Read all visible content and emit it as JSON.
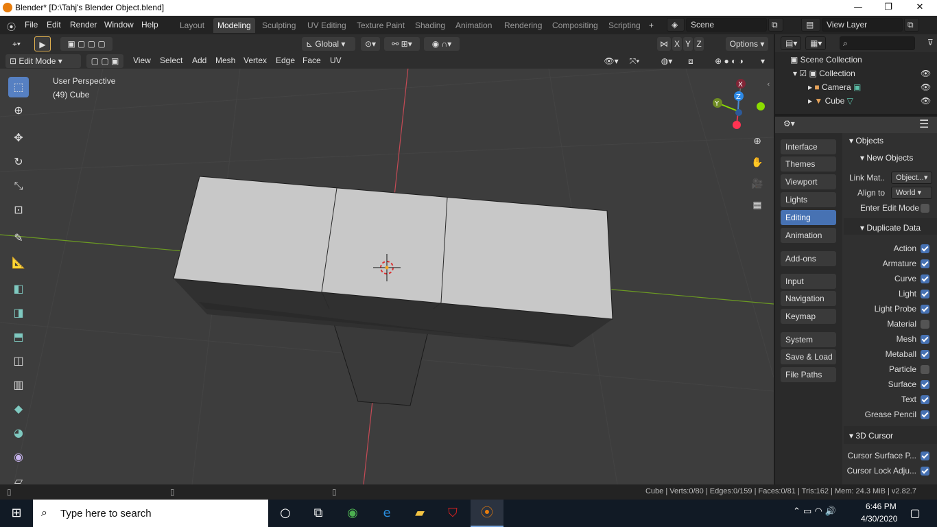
{
  "window": {
    "title": "Blender* [D:\\Tahj's Blender Object.blend]",
    "minimize": "—",
    "maximize": "❐",
    "close": "✕"
  },
  "menu": [
    "File",
    "Edit",
    "Render",
    "Window",
    "Help"
  ],
  "workspaces": [
    "Layout",
    "Modeling",
    "Sculpting",
    "UV Editing",
    "Texture Paint",
    "Shading",
    "Animation",
    "Rendering",
    "Compositing",
    "Scripting"
  ],
  "workspace_add": "+",
  "scene": {
    "name": "Scene"
  },
  "view_layer": {
    "name": "View Layer"
  },
  "viewport_header": {
    "transform_orientation": "Global",
    "options": "Options",
    "mode": "Edit Mode",
    "menus": [
      "View",
      "Select",
      "Add",
      "Mesh",
      "Vertex",
      "Edge",
      "Face",
      "UV"
    ],
    "axis_x": "X",
    "axis_y": "Y",
    "axis_z": "Z"
  },
  "viewport": {
    "perspective": "User Perspective",
    "object_info": "(49) Cube"
  },
  "gizmo": {
    "x": "X",
    "y": "Y",
    "z": "Z"
  },
  "outliner": {
    "search_placeholder": "",
    "scene_collection": "Scene Collection",
    "collection": "Collection",
    "items": [
      "Camera",
      "Cube"
    ]
  },
  "preferences": {
    "categories": [
      "Interface",
      "Themes",
      "Viewport",
      "Lights",
      "Editing",
      "Animation",
      "Add-ons",
      "Input",
      "Navigation",
      "Keymap",
      "System",
      "Save & Load",
      "File Paths"
    ],
    "active_category": "Editing",
    "objects_title": "Objects",
    "new_objects_title": "New Objects",
    "link_materials_label": "Link Mat..",
    "link_materials_value": "Object...",
    "align_to_label": "Align to",
    "align_to_value": "World",
    "enter_edit_mode_label": "Enter Edit Mode",
    "enter_edit_mode": false,
    "duplicate_data_title": "Duplicate Data",
    "duplicate": [
      {
        "label": "Action",
        "checked": true
      },
      {
        "label": "Armature",
        "checked": true
      },
      {
        "label": "Curve",
        "checked": true
      },
      {
        "label": "Light",
        "checked": true
      },
      {
        "label": "Light Probe",
        "checked": true
      },
      {
        "label": "Material",
        "checked": false
      },
      {
        "label": "Mesh",
        "checked": true
      },
      {
        "label": "Metaball",
        "checked": true
      },
      {
        "label": "Particle",
        "checked": false
      },
      {
        "label": "Surface",
        "checked": true
      },
      {
        "label": "Text",
        "checked": true
      },
      {
        "label": "Grease Pencil",
        "checked": true
      }
    ],
    "cursor_title": "3D Cursor",
    "cursor": [
      {
        "label": "Cursor Surface P...",
        "checked": true
      },
      {
        "label": "Cursor Lock Adju...",
        "checked": true
      }
    ]
  },
  "statusbar": "Cube | Verts:0/80 | Edges:0/159 | Faces:0/81 | Tris:162 | Mem: 24.3 MiB | v2.82.7",
  "taskbar": {
    "search_placeholder": "Type here to search",
    "time": "6:46 PM",
    "date": "4/30/2020"
  },
  "colors": {
    "accent": "#4772b3",
    "viewport_bg": "#3d3d3d",
    "mesh_face": "#c7c7c7",
    "x_axis": "#ff3352",
    "y_axis": "#8bdc00"
  }
}
